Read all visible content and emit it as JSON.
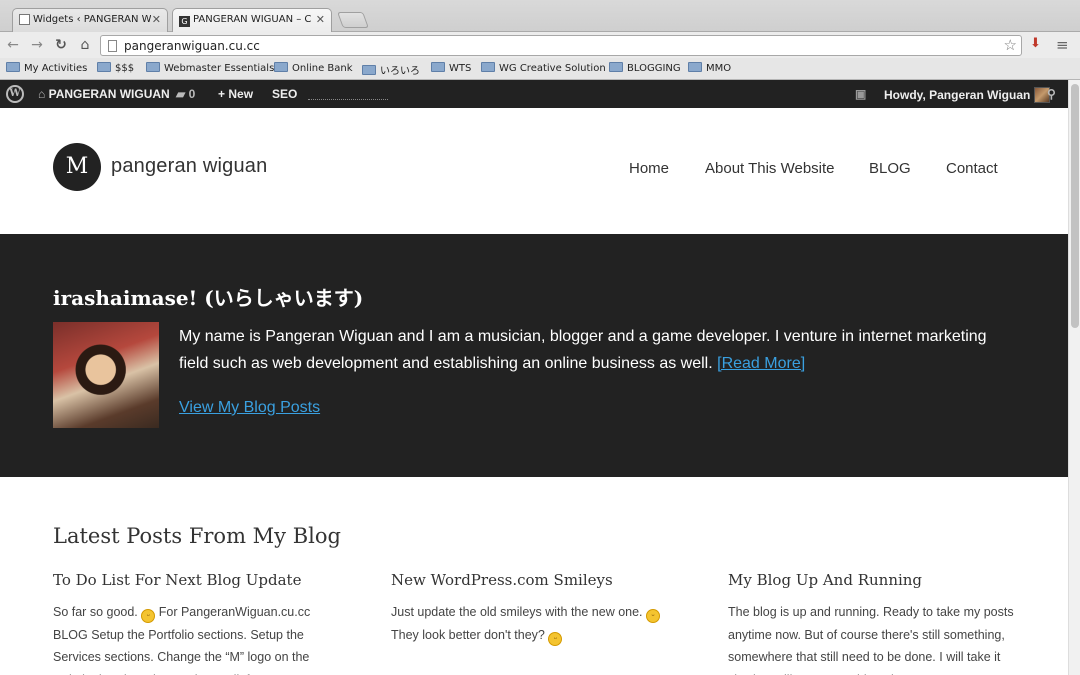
{
  "browser": {
    "tabs": [
      {
        "title": "Widgets ‹ PANGERAN WIGUAN",
        "active": false
      },
      {
        "title": "PANGERAN WIGUAN – Coll",
        "active": true
      }
    ],
    "tab_close_glyph": "✕",
    "active_tab_favicon": "G",
    "url": "pangeranwiguan.cu.cc",
    "bookmarks": [
      "My Activities",
      "$$$",
      "Webmaster Essentials",
      "Online Bank",
      "いろいろ",
      "WTS",
      "WG Creative Solution",
      "BLOGGING",
      "MMO"
    ]
  },
  "adminbar": {
    "site_name": "PANGERAN WIGUAN",
    "comments_count": "0",
    "new_label": "New",
    "seo_label": "SEO",
    "greeting": "Howdy, Pangeran Wiguan"
  },
  "header": {
    "logo_letter": "M",
    "site_name": "pangeran wiguan",
    "nav": [
      "Home",
      "About This Website",
      "BLOG",
      "Contact"
    ]
  },
  "hero": {
    "title": "irashaimase! (いらしゃいます)",
    "intro": "My name is Pangeran Wiguan and I am a musician, blogger and a game developer. I venture in internet marketing field such as web development and establishing an online business as well.",
    "read_more": "[Read More]",
    "blog_link": "View My Blog Posts"
  },
  "latest": {
    "heading": "Latest Posts From My Blog",
    "posts": [
      {
        "title": "To Do List For Next Blog Update",
        "excerpt_a": "So far so good.",
        "excerpt_b": "For PangeranWiguan.cu.cc BLOG Setup the Portfolio sections. Setup the Services sections. Change the “M” logo on the website header. Change the credit footer. SEO"
      },
      {
        "title": "New WordPress.com Smileys",
        "excerpt_a": "Just update the old smileys with the new one.",
        "excerpt_b": "They look better don't they?"
      },
      {
        "title": "My Blog Up And Running",
        "excerpt_a": "The blog is up and running. Ready to take my posts anytime now. But of course there's still something, somewhere that still need to be done. I will take it slowly. I will post something about",
        "excerpt_b": ""
      }
    ]
  }
}
